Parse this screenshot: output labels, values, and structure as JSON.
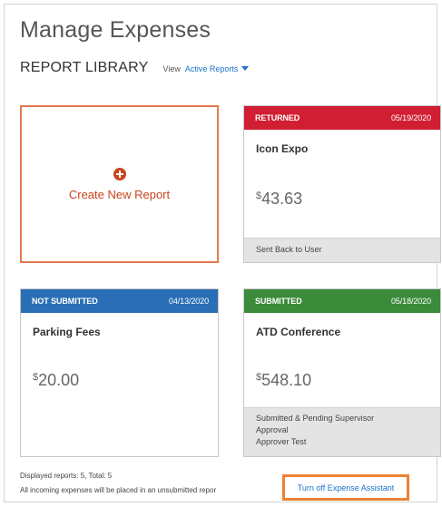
{
  "page": {
    "title": "Manage Expenses"
  },
  "library": {
    "title": "REPORT LIBRARY",
    "view_label": "View",
    "view_value": "Active Reports"
  },
  "create_card": {
    "label": "Create New Report",
    "icon": "plus-circle-icon"
  },
  "reports": [
    {
      "status": "RETURNED",
      "date": "05/19/2020",
      "name": "Icon Expo",
      "currency": "$",
      "amount": "43.63",
      "footer": [
        "Sent Back to User"
      ],
      "color": "#d01f33"
    },
    {
      "status": "NOT SUBMITTED",
      "date": "04/13/2020",
      "name": "Parking Fees",
      "currency": "$",
      "amount": "20.00",
      "footer": [],
      "color": "#2a6eb5"
    },
    {
      "status": "SUBMITTED",
      "date": "05/18/2020",
      "name": "ATD Conference",
      "currency": "$",
      "amount": "548.10",
      "footer": [
        "Submitted & Pending Supervisor",
        "Approval",
        "Approver Test"
      ],
      "color": "#3b8b3b"
    }
  ],
  "summary": {
    "counts": "Displayed reports: 5, Total: 5",
    "notice": "All incoming expenses will be placed in an unsubmitted repor",
    "assistant_link": "Turn off Expense Assistant"
  },
  "colors": {
    "accent_link": "#1a73c8",
    "create_orange": "#c9441f",
    "highlight_box": "#ee8033"
  }
}
